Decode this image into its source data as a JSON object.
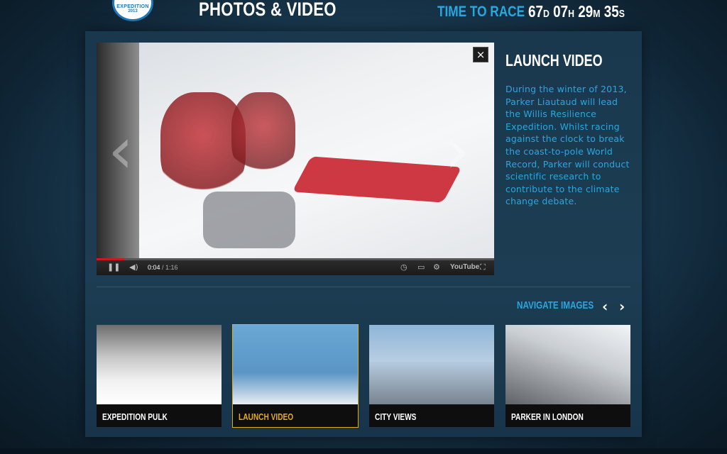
{
  "header": {
    "logo_line1": "EXPEDITION",
    "logo_line2": "2013",
    "page_title": "PHOTOS & VIDEO",
    "time_to_race_label": "TIME TO RACE",
    "countdown": {
      "days": "67",
      "days_unit": "D",
      "hours": "07",
      "hours_unit": "H",
      "minutes": "29",
      "minutes_unit": "M",
      "seconds": "35",
      "seconds_unit": "S"
    }
  },
  "video": {
    "close_label": "×",
    "current_time": "0:04",
    "duration": "/ 1:16",
    "progress_fraction": 0.07,
    "youtube_label": "YouTube"
  },
  "description": {
    "title": "LAUNCH VIDEO",
    "body": "During the winter of 2013, Parker Liautaud will lead the Willis Resilience Expedition. Whilst racing against the clock to break the coast-to-pole World Record, Parker will conduct scientific research to contribute to the climate change debate."
  },
  "navigation": {
    "label": "NAVIGATE IMAGES",
    "prev_icon": "‹",
    "next_icon": "›"
  },
  "thumbnails": [
    {
      "caption": "EXPEDITION PULK",
      "active": false
    },
    {
      "caption": "LAUNCH VIDEO",
      "active": true
    },
    {
      "caption": "CITY VIEWS",
      "active": false
    },
    {
      "caption": "PARKER IN LONDON",
      "active": false
    }
  ],
  "colors": {
    "accent_blue": "#29a7e1",
    "active_gold": "#e3a91f",
    "progress_red": "#cc181e"
  }
}
